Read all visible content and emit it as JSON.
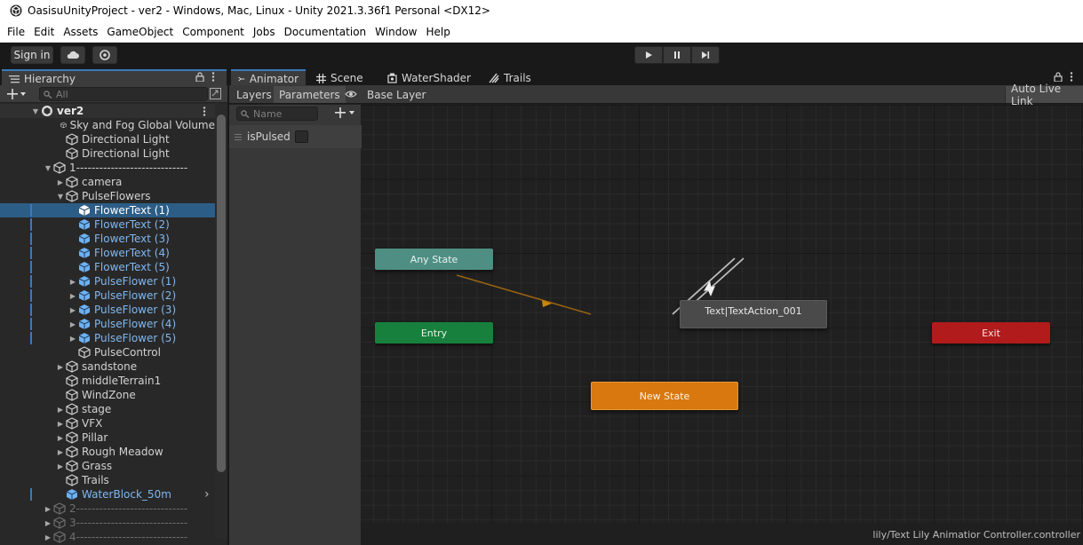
{
  "window": {
    "title": "OasisuUnityProject - ver2 - Windows, Mac, Linux - Unity 2021.3.36f1 Personal <DX12>"
  },
  "menu": [
    "File",
    "Edit",
    "Assets",
    "GameObject",
    "Component",
    "Jobs",
    "Documentation",
    "Window",
    "Help"
  ],
  "toolbar": {
    "sign_in": "Sign in"
  },
  "hierarchy": {
    "tab_label": "Hierarchy",
    "search_placeholder": "All",
    "scene": "ver2",
    "items": [
      {
        "label": "Sky and Fog Global Volume"
      },
      {
        "label": "Directional Light"
      },
      {
        "label": "Directional Light"
      },
      {
        "label": "1-----------------------------"
      },
      {
        "label": "camera"
      },
      {
        "label": "PulseFlowers"
      },
      {
        "label": "FlowerText (1)"
      },
      {
        "label": "FlowerText (2)"
      },
      {
        "label": "FlowerText (3)"
      },
      {
        "label": "FlowerText (4)"
      },
      {
        "label": "FlowerText (5)"
      },
      {
        "label": "PulseFlower (1)"
      },
      {
        "label": "PulseFlower (2)"
      },
      {
        "label": "PulseFlower (3)"
      },
      {
        "label": "PulseFlower (4)"
      },
      {
        "label": "PulseFlower (5)"
      },
      {
        "label": "PulseControl"
      },
      {
        "label": "sandstone"
      },
      {
        "label": "middleTerrain1"
      },
      {
        "label": "WindZone"
      },
      {
        "label": "stage"
      },
      {
        "label": "VFX"
      },
      {
        "label": "Pillar"
      },
      {
        "label": "Rough Meadow"
      },
      {
        "label": "Grass"
      },
      {
        "label": "Trails"
      },
      {
        "label": "WaterBlock_50m"
      },
      {
        "label": "2-----------------------------"
      },
      {
        "label": "3-----------------------------"
      },
      {
        "label": "4-----------------------------"
      }
    ]
  },
  "animator": {
    "tabs": [
      "Animator",
      "Scene",
      "WaterShader",
      "Trails"
    ],
    "layers_label": "Layers",
    "parameters_label": "Parameters",
    "breadcrumb": "Base Layer",
    "auto_live_link": "Auto Live Link",
    "param_search_placeholder": "Name",
    "parameters": [
      {
        "name": "isPulsed",
        "type": "bool",
        "value": false
      }
    ],
    "states": {
      "any_state": "Any State",
      "entry": "Entry",
      "text_action": "Text|TextAction_001",
      "new_state": "New State",
      "exit": "Exit"
    },
    "footer_path": "lily/Text Lily Animatior Controller.controller"
  },
  "colors": {
    "selection": "#2c5d87",
    "prefab_text": "#7fb7f0",
    "any_state": "#4e8e83",
    "entry": "#17803d",
    "exit": "#b11b1b",
    "default_state": "#d9780f",
    "state": "#4a4a4a"
  }
}
